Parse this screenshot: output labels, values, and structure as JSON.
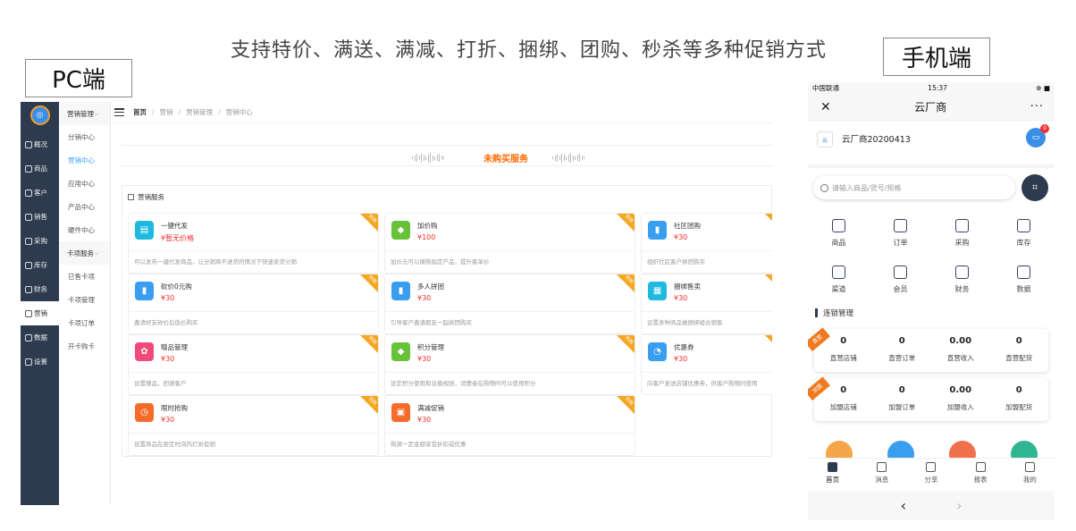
{
  "headline": "支持特价、满送、满减、打折、捆绑、团购、秒杀等多种促销方式",
  "pc_label": "PC端",
  "mobile_label": "手机端",
  "pc": {
    "logo_icon": "brand-logo",
    "nav": [
      {
        "label": "概况",
        "icon": "dashboard-icon"
      },
      {
        "label": "商品",
        "icon": "grid-icon"
      },
      {
        "label": "客户",
        "icon": "user-icon"
      },
      {
        "label": "销售",
        "icon": "document-icon"
      },
      {
        "label": "采购",
        "icon": "cart-icon"
      },
      {
        "label": "库存",
        "icon": "warehouse-icon"
      },
      {
        "label": "财务",
        "icon": "finance-icon"
      },
      {
        "label": "营销",
        "icon": "crown-icon",
        "active": true
      },
      {
        "label": "数据",
        "icon": "chart-icon"
      },
      {
        "label": "设置",
        "icon": "settings-icon"
      }
    ],
    "sub_groups": [
      {
        "title": "营销管理",
        "items": [
          "分销中心",
          "营销中心",
          "应用中心",
          "产品中心",
          "硬件中心"
        ],
        "active": "营销中心"
      },
      {
        "title": "卡项服务",
        "items": [
          "已售卡项",
          "卡项管理",
          "卡项订单",
          "开卡购卡"
        ]
      }
    ],
    "breadcrumb": [
      "首页",
      "营销",
      "营销管理",
      "营销中心"
    ],
    "unbought_title": "未购买服务",
    "services_title": "营销服务",
    "services": [
      {
        "name": "一键代发",
        "price": "¥暂无价格",
        "desc": "可以发布一键代发商品，让分销商不进货的情况下快速卖货分销",
        "color": "#1fb9e0",
        "ribbon": "热销",
        "icon": "dispatch-icon"
      },
      {
        "name": "加价购",
        "price": "¥100",
        "desc": "加价元可以换购指定产品，提升客单价",
        "color": "#67c23a",
        "ribbon": "热销",
        "icon": "tag-icon"
      },
      {
        "name": "社区团购",
        "price": "¥30",
        "desc": "组织社区客户拼团购买",
        "color": "#3a9ef0",
        "ribbon": "热销",
        "icon": "bar-chart-icon"
      },
      {
        "name": "砍价0元购",
        "price": "¥30",
        "desc": "邀请好友砍价后低价购买",
        "color": "#3a9ef0",
        "ribbon": "热销",
        "icon": "bar-chart-icon"
      },
      {
        "name": "多人拼团",
        "price": "¥30",
        "desc": "引导客户邀请朋友一起拼团购买",
        "color": "#3a9ef0",
        "ribbon": "热销",
        "icon": "bar-chart-icon"
      },
      {
        "name": "捆绑售卖",
        "price": "¥30",
        "desc": "设置多种商品做捆绑组合销售",
        "color": "#1fb9e0",
        "ribbon": "热销",
        "icon": "bundle-icon"
      },
      {
        "name": "赠品管理",
        "price": "¥30",
        "desc": "设置赠品，回馈客户",
        "color": "#f0497a",
        "ribbon": "热销",
        "icon": "gift-icon"
      },
      {
        "name": "积分管理",
        "price": "¥30",
        "desc": "设定积分使用和兑换规则，消费者在购物时可以使用积分",
        "color": "#67c23a",
        "ribbon": "热销",
        "icon": "tag-icon"
      },
      {
        "name": "优惠券",
        "price": "¥30",
        "desc": "向客户发送店铺优惠券，供客户购物时使用",
        "color": "#3a9ef0",
        "ribbon": "热销",
        "icon": "pie-icon"
      },
      {
        "name": "限时抢购",
        "price": "¥30",
        "desc": "设置商品在限定时间内打折促销",
        "color": "#f56c2a",
        "ribbon": "热销",
        "icon": "timer-icon"
      },
      {
        "name": "满减促销",
        "price": "¥30",
        "desc": "购满一定金额享受折扣或优惠",
        "color": "#f56c2a",
        "ribbon": "热销",
        "icon": "store-icon"
      }
    ]
  },
  "mobile": {
    "status": {
      "carrier": "中国联通",
      "time": "15:37",
      "battery": "⊕ ■"
    },
    "nav_title": "云厂商",
    "close_glyph": "✕",
    "more_glyph": "···",
    "shop_name": "云厂商20200413",
    "shop_logo_text": "云",
    "msg_count": "0",
    "search_placeholder": "请输入商品/货号/规格",
    "quick_icons": [
      {
        "label": "商品",
        "icon": "bag-icon"
      },
      {
        "label": "订单",
        "icon": "order-icon"
      },
      {
        "label": "采购",
        "icon": "purchase-icon"
      },
      {
        "label": "库存",
        "icon": "home-icon"
      },
      {
        "label": "渠道",
        "icon": "channel-icon"
      },
      {
        "label": "会员",
        "icon": "members-icon"
      },
      {
        "label": "财务",
        "icon": "wallet-icon"
      },
      {
        "label": "数据",
        "icon": "data-icon"
      }
    ],
    "chain_title": "连锁管理",
    "direct": {
      "tag": "直营",
      "stats": [
        {
          "value": "0",
          "label": "直营店铺"
        },
        {
          "value": "0",
          "label": "直营订单"
        },
        {
          "value": "0.00",
          "label": "直营收入"
        },
        {
          "value": "0",
          "label": "直营配货"
        }
      ]
    },
    "franchise": {
      "tag": "加盟",
      "stats": [
        {
          "value": "0",
          "label": "加盟店铺"
        },
        {
          "value": "0",
          "label": "加盟订单"
        },
        {
          "value": "0.00",
          "label": "加盟收入"
        },
        {
          "value": "0",
          "label": "加盟配货"
        }
      ]
    },
    "circle_colors": [
      "#f5a64a",
      "#3a9ef0",
      "#f0704a",
      "#2fb592"
    ],
    "tabs": [
      {
        "label": "首页",
        "icon": "home-tab-icon",
        "active": true
      },
      {
        "label": "消息",
        "icon": "message-icon"
      },
      {
        "label": "分享",
        "icon": "share-icon"
      },
      {
        "label": "报表",
        "icon": "report-icon"
      },
      {
        "label": "我的",
        "icon": "profile-icon"
      }
    ]
  }
}
